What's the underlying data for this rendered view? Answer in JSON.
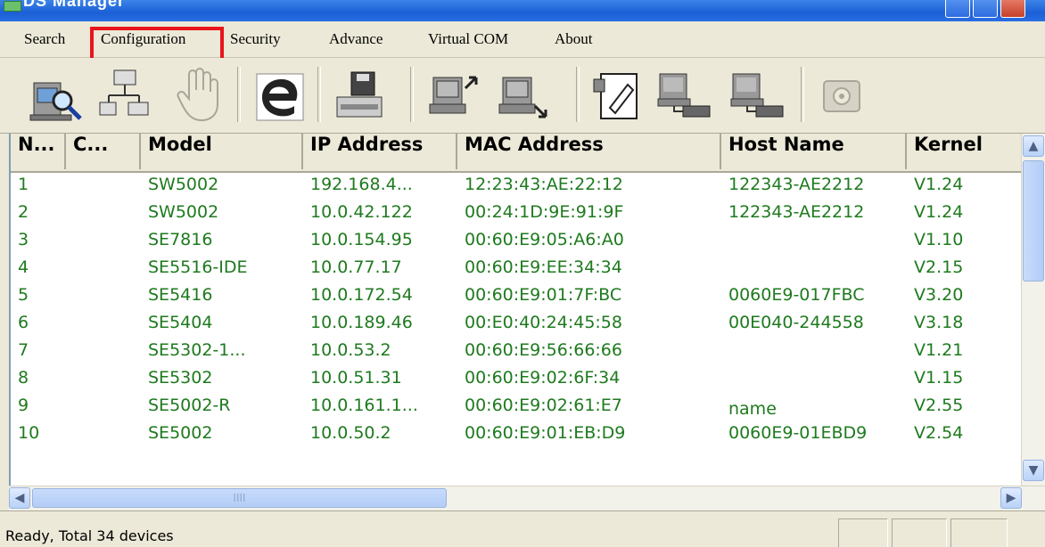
{
  "window": {
    "title": "DS Manager"
  },
  "menu": {
    "items": [
      {
        "label": "Search"
      },
      {
        "label": "Configuration"
      },
      {
        "label": "Security"
      },
      {
        "label": "Advance"
      },
      {
        "label": "Virtual COM"
      },
      {
        "label": "About"
      }
    ],
    "highlighted": "Configuration",
    "highlight_color": "#e8161b"
  },
  "toolbar": {
    "buttons": [
      {
        "icon": "search-device-icon"
      },
      {
        "icon": "network-icon"
      },
      {
        "icon": "hand-icon",
        "disabled": true
      },
      {
        "icon": "internet-explorer-icon"
      },
      {
        "icon": "save-device-icon"
      },
      {
        "icon": "upload-icon"
      },
      {
        "icon": "download-icon"
      },
      {
        "icon": "edit-config-icon"
      },
      {
        "icon": "connect-device-icon"
      },
      {
        "icon": "connect-device-2-icon"
      },
      {
        "icon": "telephone-icon",
        "disabled": true
      }
    ]
  },
  "table": {
    "headers": [
      "N...",
      "C...",
      "Model",
      "IP Address",
      "MAC Address",
      "Host Name",
      "Kernel"
    ],
    "rows": [
      [
        "1",
        "",
        "SW5002",
        "192.168.4...",
        "12:23:43:AE:22:12",
        "122343-AE2212",
        "V1.24"
      ],
      [
        "2",
        "",
        "SW5002",
        "10.0.42.122",
        "00:24:1D:9E:91:9F",
        "122343-AE2212",
        "V1.24"
      ],
      [
        "3",
        "",
        "SE7816",
        "10.0.154.95",
        "00:60:E9:05:A6:A0",
        "",
        "V1.10"
      ],
      [
        "4",
        "",
        "SE5516-IDE",
        "10.0.77.17",
        "00:60:E9:EE:34:34",
        "",
        "V2.15"
      ],
      [
        "5",
        "",
        "SE5416",
        "10.0.172.54",
        "00:60:E9:01:7F:BC",
        "0060E9-017FBC",
        "V3.20"
      ],
      [
        "6",
        "",
        "SE5404",
        "10.0.189.46",
        "00:E0:40:24:45:58",
        "00E040-244558",
        "V3.18"
      ],
      [
        "7",
        "",
        "SE5302-1...",
        "10.0.53.2",
        "00:60:E9:56:66:66",
        "",
        "V1.21"
      ],
      [
        "8",
        "",
        "SE5302",
        "10.0.51.31",
        "00:60:E9:02:6F:34",
        "",
        "V1.15"
      ],
      [
        "9",
        "",
        "SE5002-R",
        "10.0.161.1...",
        "00:60:E9:02:61:E7",
        "name",
        "V2.55"
      ],
      [
        "10",
        "",
        "SE5002",
        "10.0.50.2",
        "00:60:E9:01:EB:D9",
        "0060E9-01EBD9",
        "V2.54"
      ]
    ],
    "text_color": "#1e7a1e"
  },
  "scrollbars": {
    "up_arrow": "▲",
    "down_arrow": "▼",
    "left_arrow": "◀",
    "right_arrow": "▶",
    "grip": "IIII"
  },
  "status": {
    "text": "Ready, Total 34 devices"
  }
}
